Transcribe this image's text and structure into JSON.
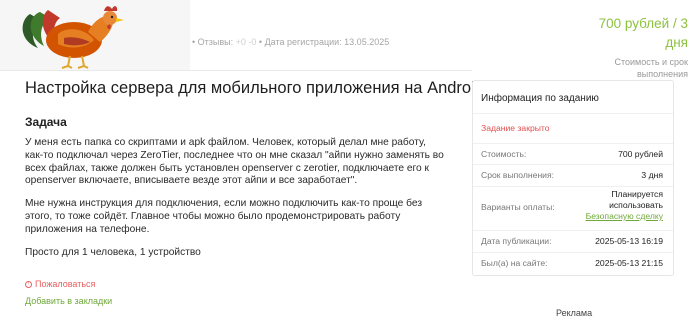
{
  "header": {
    "reviews_label": "Отзывы:",
    "reviews_value": "+0 -0",
    "reg_label": "Дата регистрации:",
    "reg_date": "13.05.2025",
    "price_line1": "700 рублей / 3",
    "price_line2": "дня",
    "price_note_line1": "Стоимость и срок",
    "price_note_line2": "выполнения"
  },
  "main": {
    "title": "Настройка сервера для мобильного приложения на Android",
    "task_heading": "Задача",
    "paragraphs": [
      "У меня есть папка со скриптами и apk файлом. Человек, который делал мне работу, как-то подключал через ZeroTier, последнее что он мне сказал \"айпи нужно заменять во всех файлах, также должен быть установлен openserver с zerotier, подключаете его к openserver включаете, вписываете везде этот айпи и все заработает\".",
      "Мне нужна инструкция для подключения, если можно подключить как-то проще без этого, то тоже сойдёт. Главное чтобы можно было продемонстрировать работу приложения на телефоне.",
      "Просто для 1 человека, 1 устройство"
    ],
    "complain": "Пожаловаться",
    "bookmark": "Добавить в закладки"
  },
  "info": {
    "heading": "Информация по заданию",
    "status": "Задание закрыто",
    "cost_label": "Стоимость:",
    "cost_value": "700 рублей",
    "term_label": "Срок выполнения:",
    "term_value": "3 дня",
    "payment_label": "Варианты оплаты:",
    "payment_line1": "Планируется",
    "payment_line2": "использовать",
    "payment_link": "Безопасную сделку",
    "published_label": "Дата публикации:",
    "published_value": "2025-05-13 16:19",
    "online_label": "Был(а) на сайте:",
    "online_value": "2025-05-13 21:15"
  },
  "ads_label": "Реклама",
  "colors": {
    "accent_green": "#8cc23f",
    "link_green": "#6fa83a",
    "alert_red": "#e05050"
  },
  "icons": {
    "logo": "rooster-logo",
    "complain": "complain-icon"
  }
}
